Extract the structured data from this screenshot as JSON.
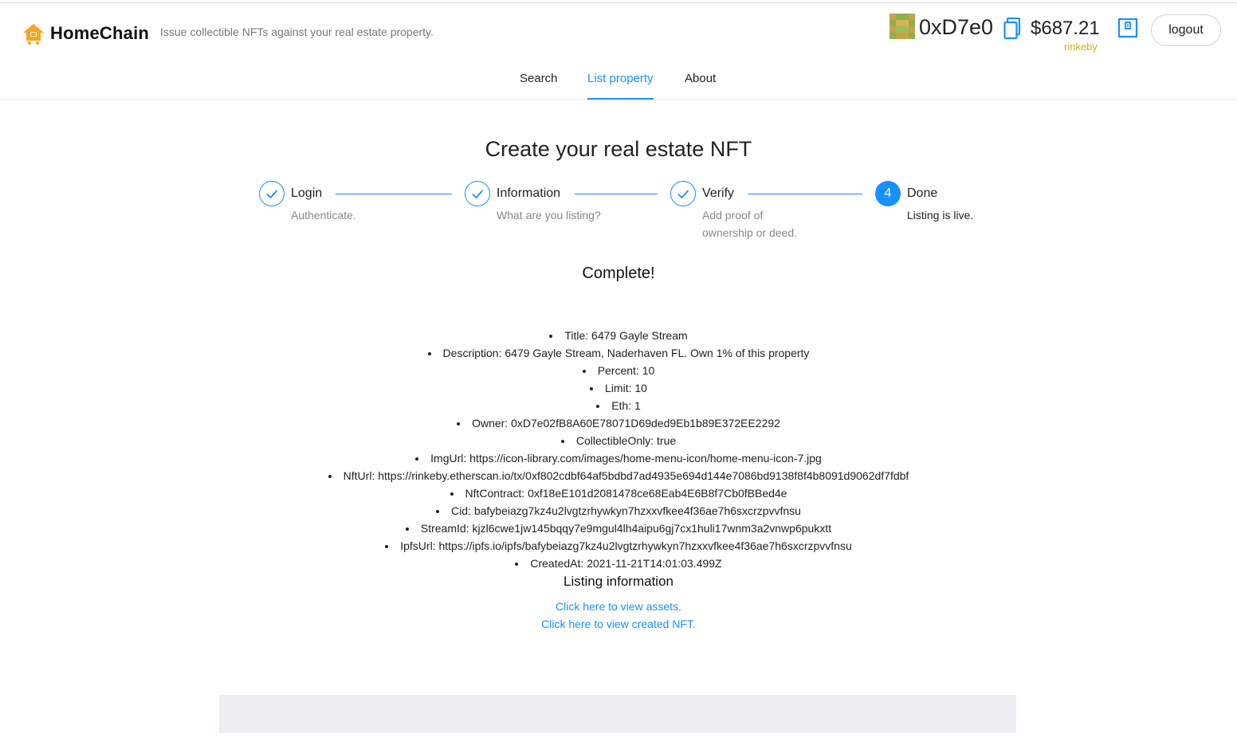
{
  "header": {
    "logo_text": "HomeChain",
    "tagline": "Issue collectible NFTs against your real estate property.",
    "address": "0xD7e0",
    "balance": "$687.21",
    "network": "rinkeby",
    "logout_label": "logout",
    "icons": {
      "logo": "house-cart-icon",
      "avatar": "identicon-avatar",
      "copy": "copy-icon",
      "wallet": "wallet-icon"
    }
  },
  "nav": {
    "tabs": [
      {
        "label": "Search",
        "active": false
      },
      {
        "label": "List property",
        "active": true
      },
      {
        "label": "About",
        "active": false
      }
    ]
  },
  "main": {
    "title": "Create your real estate NFT",
    "steps": [
      {
        "number": "",
        "title": "Login",
        "description": "Authenticate.",
        "status": "finished"
      },
      {
        "number": "",
        "title": "Information",
        "description": "What are you listing?",
        "status": "finished"
      },
      {
        "number": "",
        "title": "Verify",
        "description": "Add proof of ownership or deed.",
        "status": "finished"
      },
      {
        "number": "4",
        "title": "Done",
        "description": "Listing is live.",
        "status": "current"
      }
    ],
    "complete_heading": "Complete!",
    "details": [
      "Title: 6479 Gayle Stream",
      "Description: 6479 Gayle Stream, Naderhaven FL. Own 1% of this property",
      "Percent: 10",
      "Limit: 10",
      "Eth: 1",
      "Owner: 0xD7e02fB8A60E78071D69ded9Eb1b89E372EE2292",
      "CollectibleOnly: true",
      "ImgUrl: https://icon-library.com/images/home-menu-icon/home-menu-icon-7.jpg",
      "NftUrl: https://rinkeby.etherscan.io/tx/0xf802cdbf64af5bdbd7ad4935e694d144e7086bd9138f8f4b8091d9062df7fdbf",
      "NftContract: 0xf18eE101d2081478ce68Eab4E6B8f7Cb0fBBed4e",
      "Cid: bafybeiazg7kz4u2lvgtzrhywkyn7hzxxvfkee4f36ae7h6sxcrzpvvfnsu",
      "StreamId: kjzl6cwe1jw145bqqy7e9mgul4lh4aipu6gj7cx1huli17wnm3a2vnwp6pukxtt",
      "IpfsUrl: https://ipfs.io/ipfs/bafybeiazg7kz4u2lvgtzrhywkyn7hzxxvfkee4f36ae7h6sxcrzpvvfnsu",
      "CreatedAt: 2021-11-21T14:01:03.499Z"
    ],
    "listing_info_heading": "Listing information",
    "links": {
      "view_assets": "Click here to view assets.",
      "view_nft": "Click here to view created NFT."
    }
  },
  "colors": {
    "accent": "#1890ff",
    "network": "#d4b106",
    "footer_bar": "#eeeff2"
  }
}
